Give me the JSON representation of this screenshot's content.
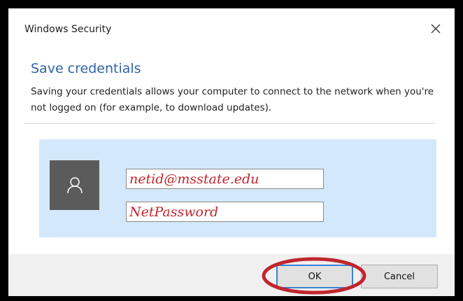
{
  "window": {
    "title": "Windows Security"
  },
  "dialog": {
    "heading": "Save credentials",
    "description": "Saving your credentials allows your computer to connect to the network when you're not logged on (for example, to download updates)."
  },
  "credentials": {
    "username_value": "netid@msstate.edu",
    "password_value": "NetPassword"
  },
  "buttons": {
    "ok_label": "OK",
    "cancel_label": "Cancel"
  },
  "icons": {
    "close": "close-icon",
    "user": "user-icon"
  },
  "colors": {
    "heading": "#2f63a8",
    "panel_background": "#d4e8fb",
    "annotation_red": "#c0262e",
    "default_button_border": "#3b82d6"
  }
}
